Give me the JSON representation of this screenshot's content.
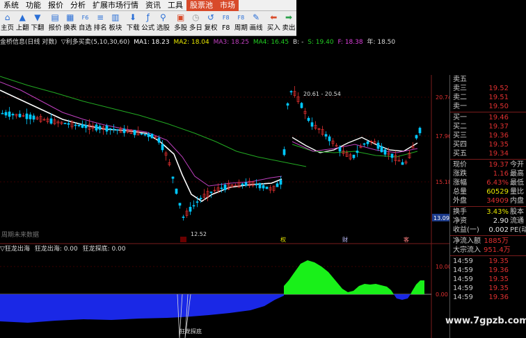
{
  "menu": [
    "系统",
    "功能",
    "报价",
    "分析",
    "扩展市场行情",
    "资讯",
    "工具",
    "股票池",
    "市场"
  ],
  "toolbar": [
    {
      "label": "主页",
      "icon": "home-icon",
      "glyph": "⌂",
      "color": "#2a6fd6"
    },
    {
      "label": "上翻",
      "icon": "page-up-icon",
      "glyph": "▲",
      "color": "#2a6fd6"
    },
    {
      "label": "下翻",
      "icon": "page-down-icon",
      "glyph": "▼",
      "color": "#2a6fd6"
    },
    {
      "label": "报价",
      "icon": "quote-icon",
      "glyph": "▤",
      "color": "#2a6fd6"
    },
    {
      "label": "换表",
      "icon": "switch-table-icon",
      "glyph": "▦",
      "color": "#2a6fd6"
    },
    {
      "label": "自选",
      "icon": "watchlist-icon",
      "glyph": "F6",
      "color": "#2a6fd6"
    },
    {
      "label": "排名",
      "icon": "ranking-icon",
      "glyph": "≡",
      "color": "#2a6fd6"
    },
    {
      "label": "板块",
      "icon": "sector-icon",
      "glyph": "▥",
      "color": "#2a6fd6"
    },
    {
      "label": "下载",
      "icon": "download-icon",
      "glyph": "⬇",
      "color": "#2a6fd6"
    },
    {
      "label": "公式",
      "icon": "formula-icon",
      "glyph": "ƒ",
      "color": "#2a6fd6"
    },
    {
      "label": "选股",
      "icon": "stock-picker-icon",
      "glyph": "⚲",
      "color": "#2a6fd6"
    },
    {
      "label": "多股",
      "icon": "multi-stock-icon",
      "glyph": "▣",
      "color": "#d84a2a"
    },
    {
      "label": "多日",
      "icon": "multi-day-icon",
      "glyph": "◷",
      "color": "#999999"
    },
    {
      "label": "复权",
      "icon": "adjust-icon",
      "glyph": "↺",
      "color": "#2a6fd6"
    },
    {
      "label": "F8",
      "icon": "f8-icon",
      "glyph": "F8",
      "color": "#2a6fd6"
    },
    {
      "label": "周期",
      "icon": "period-icon",
      "glyph": "F8",
      "color": "#2a6fd6"
    },
    {
      "label": "画线",
      "icon": "draw-line-icon",
      "glyph": "✎",
      "color": "#2a6fd6"
    },
    {
      "label": "买入",
      "icon": "buy-icon",
      "glyph": "⬅",
      "color": "#d84a2a"
    },
    {
      "label": "卖出",
      "icon": "sell-icon",
      "glyph": "➡",
      "color": "#2aa04a"
    }
  ],
  "info": {
    "title": "金桥信息(日线 对数)",
    "indicator": "▽利多买卖(5,10,30,60)",
    "ma1": "MA1: 18.23",
    "ma2": "MA2: 18.04",
    "ma3": "MA3: 18.25",
    "ma4": "MA4: 16.45",
    "b": "B: -",
    "s": "S: 19.40",
    "f": "F: 18.38",
    "year": "年: 18.50"
  },
  "sub": {
    "title": "▽狂龙出海",
    "v1": "狂龙出海: 0.00",
    "v2": "狂龙探底: 0.00",
    "future": "周期未来数据",
    "bottom_label": "狂龙探底"
  },
  "quote": [
    {
      "k": "卖五",
      "v": "",
      "c": "#e03030"
    },
    {
      "k": "卖三",
      "v": "19.52",
      "c": "#e03030"
    },
    {
      "k": "卖二",
      "v": "19.51",
      "c": "#e03030"
    },
    {
      "k": "卖一",
      "v": "19.50",
      "c": "#e03030"
    },
    {
      "k": "买一",
      "v": "19.46",
      "c": "#e03030"
    },
    {
      "k": "买二",
      "v": "19.37",
      "c": "#e03030"
    },
    {
      "k": "买三",
      "v": "19.36",
      "c": "#e03030"
    },
    {
      "k": "买四",
      "v": "19.35",
      "c": "#e03030"
    },
    {
      "k": "买五",
      "v": "19.34",
      "c": "#e03030"
    }
  ],
  "stats": [
    {
      "k": "现价",
      "v": "19.37",
      "c": "#e03030",
      "k2": "今开",
      "v2": ""
    },
    {
      "k": "涨跌",
      "v": "1.16",
      "c": "#e03030",
      "k2": "最高",
      "v2": ""
    },
    {
      "k": "涨幅",
      "v": "6.43%",
      "c": "#e03030",
      "k2": "最低",
      "v2": ""
    },
    {
      "k": "总量",
      "v": "60529",
      "c": "#e8e800",
      "k2": "量比",
      "v2": ""
    },
    {
      "k": "外盘",
      "v": "34909",
      "c": "#e03030",
      "k2": "内盘",
      "v2": ""
    }
  ],
  "stats2": [
    {
      "k": "换手",
      "v": "3.43%",
      "c": "#e8e800",
      "k2": "股本",
      "v2": ""
    },
    {
      "k": "净资",
      "v": "2.90",
      "c": "#e8e8e8",
      "k2": "流通",
      "v2": ""
    },
    {
      "k": "收益(一)",
      "v": "0.002",
      "c": "#e8e8e8",
      "k2": "PE(动)",
      "v2": ""
    }
  ],
  "flows": [
    {
      "k": "净流入额",
      "v": "1885万",
      "c": "#e03030"
    },
    {
      "k": "大宗流入",
      "v": "951.4万",
      "c": "#e03030"
    }
  ],
  "ticks": [
    {
      "t": "14:59",
      "p": "19.35",
      "c": "#e03030"
    },
    {
      "t": "14:59",
      "p": "19.36",
      "c": "#e03030"
    },
    {
      "t": "14:59",
      "p": "19.35",
      "c": "#e03030"
    },
    {
      "t": "14:59",
      "p": "19.35",
      "c": "#e03030"
    },
    {
      "t": "14:59",
      "p": "19.36",
      "c": "#e03030"
    }
  ],
  "axis": {
    "price_labels": [
      "20.74",
      "17.96",
      "15.18",
      "13.09"
    ],
    "sub_labels": [
      "10.00",
      "0.00"
    ]
  },
  "annotations": {
    "high": "20.61 - 20.54",
    "low": "12.52",
    "markers": [
      "权",
      "财",
      "客"
    ]
  },
  "watermark": "www.7gpzb.com",
  "colors": {
    "up": "#e03030",
    "down": "#00c8ff",
    "ma_white": "#ffffff",
    "ma_green": "#22aa22",
    "ma_purple": "#c040c0",
    "accent": "#d84a2a"
  }
}
